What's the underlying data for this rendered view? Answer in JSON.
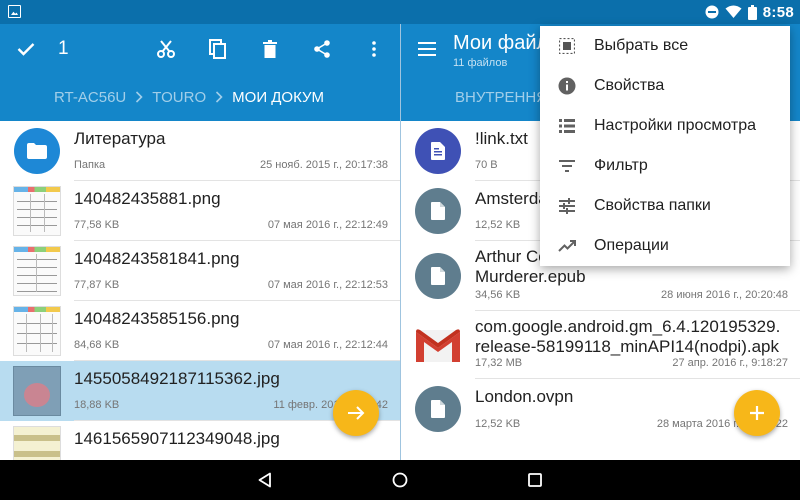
{
  "status": {
    "time": "8:58"
  },
  "left": {
    "selection_count": "1",
    "breadcrumbs": [
      "RT-AC56U",
      "TOURO",
      "МОИ ДОКУМ"
    ],
    "files": [
      {
        "name": "Литература",
        "meta": "Папка",
        "date": "25 нояб. 2015 г., 20:17:38",
        "kind": "folder"
      },
      {
        "name": "140482435881.png",
        "meta": "77,58 KB",
        "date": "07 мая 2016 г., 22:12:49",
        "kind": "doc"
      },
      {
        "name": "14048243581841.png",
        "meta": "77,87 KB",
        "date": "07 мая 2016 г., 22:12:53",
        "kind": "doc"
      },
      {
        "name": "14048243585156.png",
        "meta": "84,68 KB",
        "date": "07 мая 2016 г., 22:12:44",
        "kind": "doc"
      },
      {
        "name": "1455058492187115362.jpg",
        "meta": "18,88 KB",
        "date": "11 февр. 2016 г., 18:42",
        "kind": "photo",
        "selected": true
      },
      {
        "name": "1461565907112349048.jpg",
        "meta": "",
        "date": "",
        "kind": "paper"
      }
    ]
  },
  "right": {
    "title": "Мои файлы",
    "subtitle": "11 файлов",
    "tab": "ВНУТРЕННЯЯ",
    "files": [
      {
        "name": "!link.txt",
        "meta": "70 B",
        "date": "",
        "kind": "text"
      },
      {
        "name": "Amsterdam.ovpn",
        "meta": "12,52 KB",
        "date": "",
        "kind": "file"
      },
      {
        "name": "Arthur Conan Doyle - The Murderer.epub",
        "line1": "Arthur Conan Doyle - The",
        "line2": "Murderer.epub",
        "meta": "34,56 KB",
        "date": "28 июня 2016 г., 20:20:48",
        "kind": "file"
      },
      {
        "name": "com.google.android.gm_6.4.120195329.release-58199118_minAPI14(nodpi).apk",
        "line1": "com.google.android.gm_6.4.120195329.",
        "line2": "release-58199118_minAPI14(nodpi).apk",
        "meta": "17,32 MB",
        "date": "27 апр. 2016 г., 9:18:27",
        "kind": "gmail"
      },
      {
        "name": "London.ovpn",
        "meta": "12,52 KB",
        "date": "28 марта 2016 г., 10:56:22",
        "kind": "file"
      }
    ]
  },
  "menu": {
    "items": [
      {
        "label": "Выбрать все",
        "icon": "select-all-icon"
      },
      {
        "label": "Свойства",
        "icon": "info-icon"
      },
      {
        "label": "Настройки просмотра",
        "icon": "list-view-icon"
      },
      {
        "label": "Фильтр",
        "icon": "filter-icon"
      },
      {
        "label": "Свойства папки",
        "icon": "tune-icon"
      },
      {
        "label": "Операции",
        "icon": "trending-icon"
      }
    ]
  },
  "colors": {
    "primary": "#1486c9",
    "status": "#0b6fab",
    "accent": "#f7b719",
    "selected": "#b8dcf0",
    "folder": "#1e88d6",
    "file": "#5f7d8e",
    "text": "#3f51b5"
  }
}
